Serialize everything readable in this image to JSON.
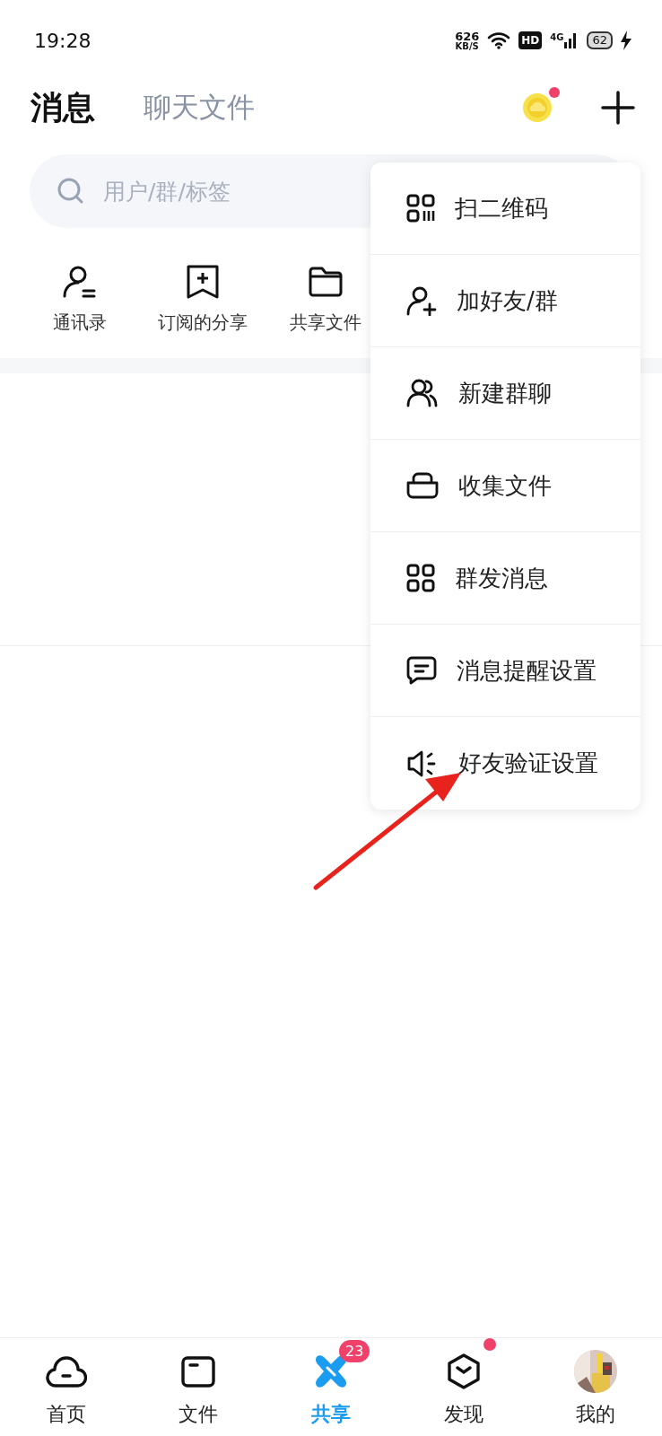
{
  "status_bar": {
    "time": "19:28",
    "speed": "626",
    "speed_unit": "KB/S",
    "hd": "HD",
    "network": "4G",
    "battery": "62"
  },
  "header": {
    "tabs": [
      {
        "label": "消息",
        "selected": true
      },
      {
        "label": "聊天文件",
        "selected": false
      }
    ],
    "coin_dot": true
  },
  "search": {
    "placeholder": "用户/群/标签"
  },
  "shortcuts": [
    {
      "label": "通讯录",
      "kind": "contacts"
    },
    {
      "label": "订阅的分享",
      "kind": "bookmark"
    },
    {
      "label": "共享文件",
      "kind": "folder"
    }
  ],
  "menu": [
    {
      "label": "扫二维码",
      "kind": "qr"
    },
    {
      "label": "加好友/群",
      "kind": "add-user"
    },
    {
      "label": "新建群聊",
      "kind": "users"
    },
    {
      "label": "收集文件",
      "kind": "tray"
    },
    {
      "label": "群发消息",
      "kind": "grid"
    },
    {
      "label": "消息提醒设置",
      "kind": "chat"
    },
    {
      "label": "好友验证设置",
      "kind": "speaker"
    }
  ],
  "nav": [
    {
      "label": "首页",
      "kind": "cloud",
      "selected": false
    },
    {
      "label": "文件",
      "kind": "folder",
      "selected": false
    },
    {
      "label": "共享",
      "kind": "share",
      "selected": true,
      "badge": "23"
    },
    {
      "label": "发现",
      "kind": "cube",
      "selected": false,
      "dot": true
    },
    {
      "label": "我的",
      "kind": "avatar",
      "selected": false
    }
  ]
}
